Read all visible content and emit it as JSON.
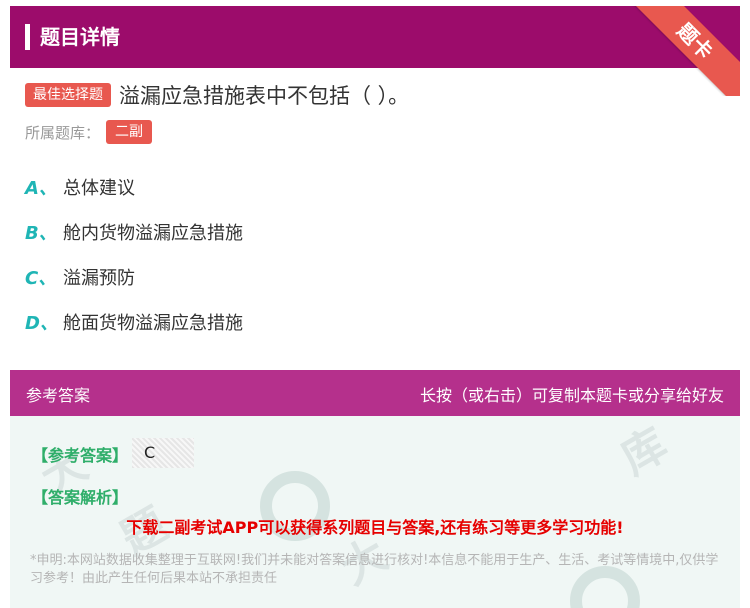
{
  "header": {
    "title": "题目详情",
    "ribbon": "题卡"
  },
  "question": {
    "type_tag": "最佳选择题",
    "text": "溢漏应急措施表中不包括（    ）。",
    "bank_label": "所属题库：",
    "bank": "二副"
  },
  "options": [
    {
      "letter": "A、",
      "text": "总体建议"
    },
    {
      "letter": "B、",
      "text": "舱内货物溢漏应急措施"
    },
    {
      "letter": "C、",
      "text": "溢漏预防"
    },
    {
      "letter": "D、",
      "text": "舱面货物溢漏应急措施"
    }
  ],
  "answer": {
    "section_title": "参考答案",
    "copy_hint": "长按（或右击）可复制本题卡或分享给好友",
    "ref_label": "【参考答案】",
    "ref_value": "C",
    "analysis_label": "【答案解析】",
    "promo": "下载二副考试APP可以获得系列题目与答案,还有练习等更多学习功能!",
    "disclaimer": "*申明:本网站数据收集整理于互联网!我们并未能对答案信息进行核对!本信息不能用于生产、生活、考试等情境中,仅供学习参考！由此产生任何后果本站不承担责任"
  },
  "colors": {
    "header_bg": "#9c0c6b",
    "accent_red": "#e8584f",
    "option_letter": "#1fb5b5",
    "answer_header_bg": "#b5308c",
    "answer_label": "#2fae6a",
    "promo_red": "#e60000"
  }
}
